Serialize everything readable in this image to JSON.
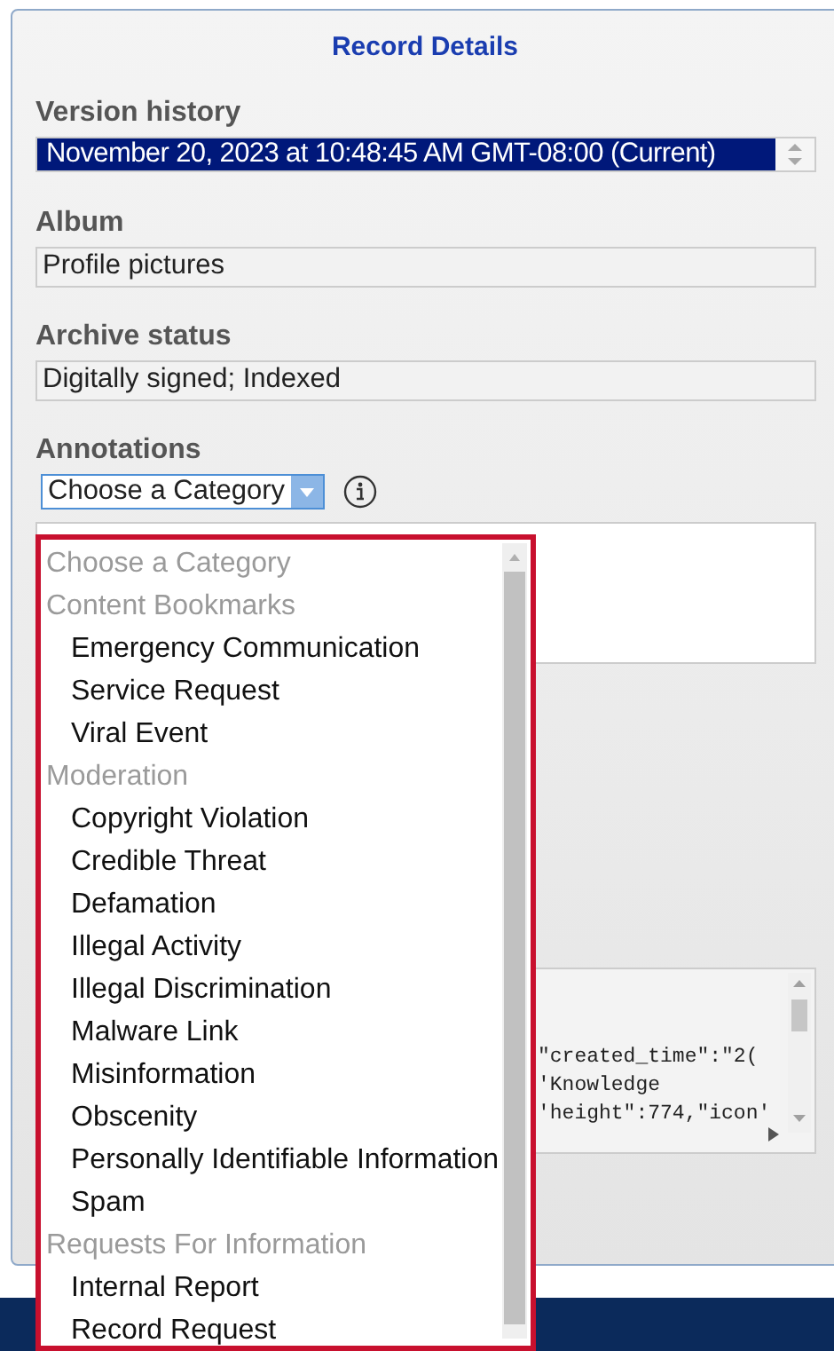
{
  "dialog": {
    "title": "Record Details"
  },
  "fields": [
    {
      "label": "Version history",
      "kind": "select",
      "value": "November 20, 2023 at 10:48:45 AM GMT-08:00 (Current)"
    },
    {
      "label": "Album",
      "kind": "text",
      "value": "Profile pictures"
    },
    {
      "label": "Archive status",
      "kind": "text",
      "value": "Digitally signed; Indexed"
    }
  ],
  "annotations": {
    "label": "Annotations",
    "category_select": "Choose a Category",
    "expanded": true
  },
  "code_lines": [
    "\"created_time\":\"2(",
    "'Knowledge",
    "'height\":774,\"icon'"
  ],
  "dropdown_items": [
    {
      "label": "Choose a Category",
      "kind": "placeholder"
    },
    {
      "label": "Content Bookmarks",
      "kind": "group"
    },
    {
      "label": "Emergency Communication",
      "kind": "option"
    },
    {
      "label": "Service Request",
      "kind": "option"
    },
    {
      "label": "Viral Event",
      "kind": "option"
    },
    {
      "label": "Moderation",
      "kind": "group"
    },
    {
      "label": "Copyright Violation",
      "kind": "option"
    },
    {
      "label": "Credible Threat",
      "kind": "option"
    },
    {
      "label": "Defamation",
      "kind": "option"
    },
    {
      "label": "Illegal Activity",
      "kind": "option"
    },
    {
      "label": "Illegal Discrimination",
      "kind": "option"
    },
    {
      "label": "Malware Link",
      "kind": "option"
    },
    {
      "label": "Misinformation",
      "kind": "option"
    },
    {
      "label": "Obscenity",
      "kind": "option"
    },
    {
      "label": "Personally Identifiable Information",
      "kind": "option"
    },
    {
      "label": "Spam",
      "kind": "option"
    },
    {
      "label": "Requests For Information",
      "kind": "group"
    },
    {
      "label": "Internal Report",
      "kind": "option"
    },
    {
      "label": "Record Request",
      "kind": "option"
    }
  ]
}
